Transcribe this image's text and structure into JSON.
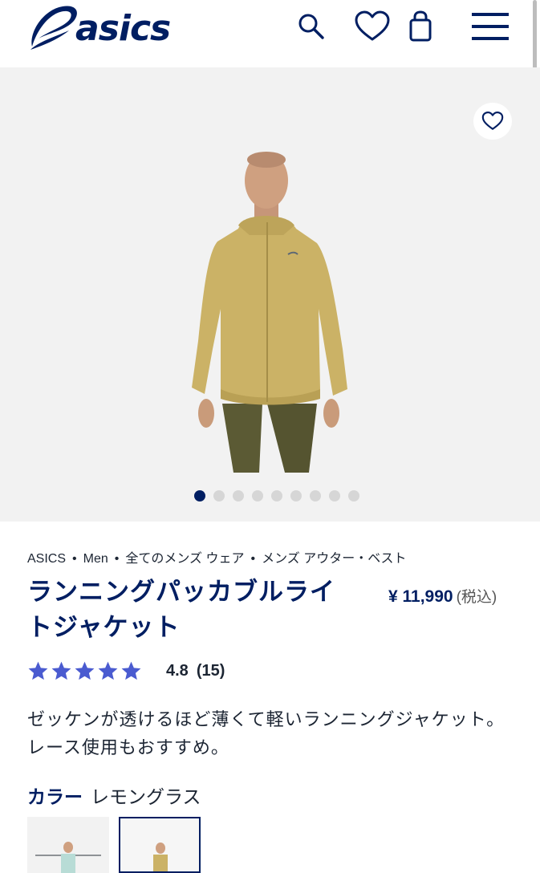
{
  "header": {
    "brand": "asics",
    "icons": [
      "search-icon",
      "heart-icon",
      "shopping-bag-icon",
      "menu-icon"
    ]
  },
  "gallery": {
    "image_count": 9,
    "active_index": 0
  },
  "breadcrumb": [
    "ASICS",
    "Men",
    "全てのメンズ ウェア",
    "メンズ アウター・ベスト"
  ],
  "product": {
    "title": "ランニングパッカブルライトジャケット",
    "price": "¥ 11,990",
    "tax_note": "(税込)",
    "rating_value": "4.8",
    "rating_count": "(15)",
    "stars": 5,
    "description": "ゼッケンが透けるほど薄くて軽いランニングジャケット。レース使用もおすすめ。",
    "color_label": "カラー",
    "color_value": "レモングラス"
  },
  "colors": {
    "accent": "#001e62",
    "star": "#4a5bd0",
    "jacket": "#cbb266",
    "pants": "#5b5a34",
    "gallery_bg": "#f2f2f2"
  }
}
